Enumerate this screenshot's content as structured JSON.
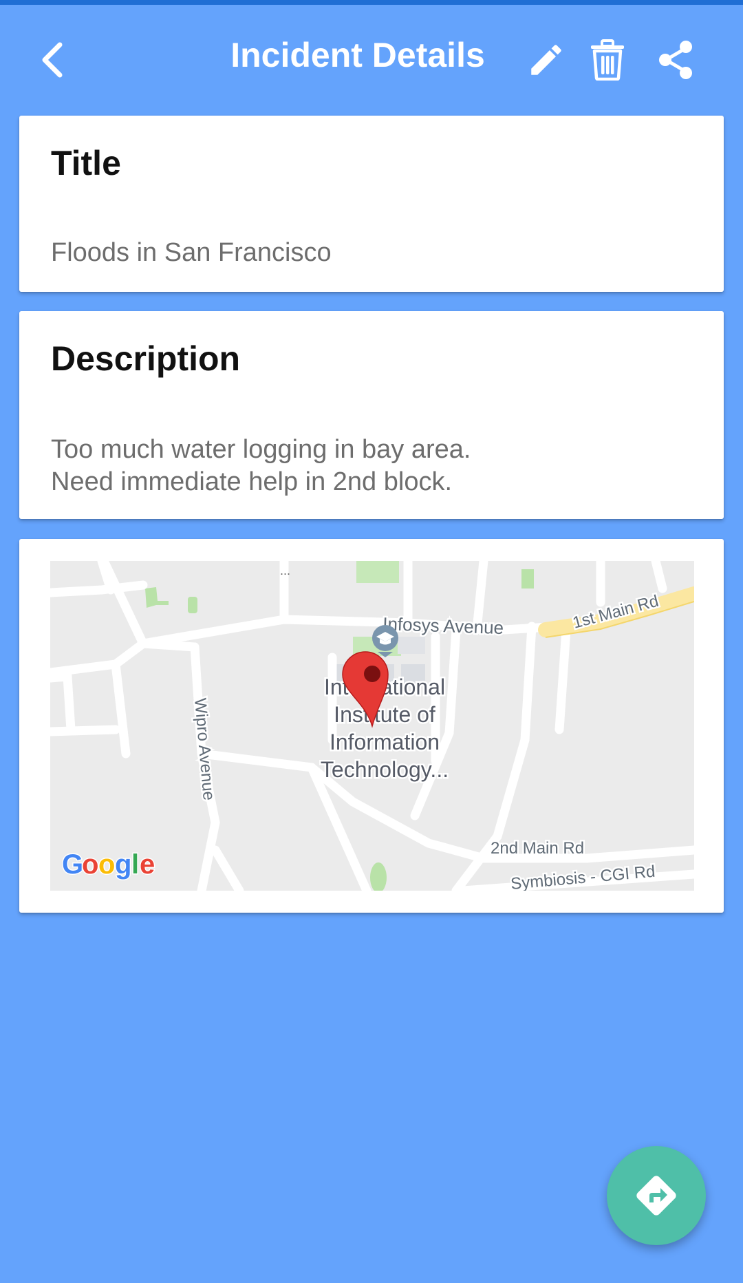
{
  "app_bar": {
    "title": "Incident Details",
    "back_icon": "chevron-left-icon",
    "actions": [
      "pencil-icon",
      "trash-icon",
      "share-icon"
    ],
    "color": "#64a3fc"
  },
  "title_card": {
    "heading": "Title",
    "value": "Floods in San Francisco"
  },
  "description_card": {
    "heading": "Description",
    "lines": [
      "Too much water logging in bay area.",
      "Need immediate help in 2nd block."
    ]
  },
  "map": {
    "labels": {
      "infosys": "Infosys Avenue",
      "first_main": "1st Main Rd",
      "wipro": "Wipro Avenue",
      "iiit_lines": [
        "International",
        "Institute of",
        "Information",
        "Technology..."
      ],
      "second_main": "2nd Main Rd",
      "symbiosis": "Symbiosis - CGI Rd",
      "ellipsis": "..."
    },
    "attribution": [
      "G",
      "o",
      "o",
      "g",
      "l",
      "e"
    ],
    "pin_color": "#e53935"
  },
  "fab": {
    "icon": "directions-icon",
    "color": "#4fbfa8"
  }
}
